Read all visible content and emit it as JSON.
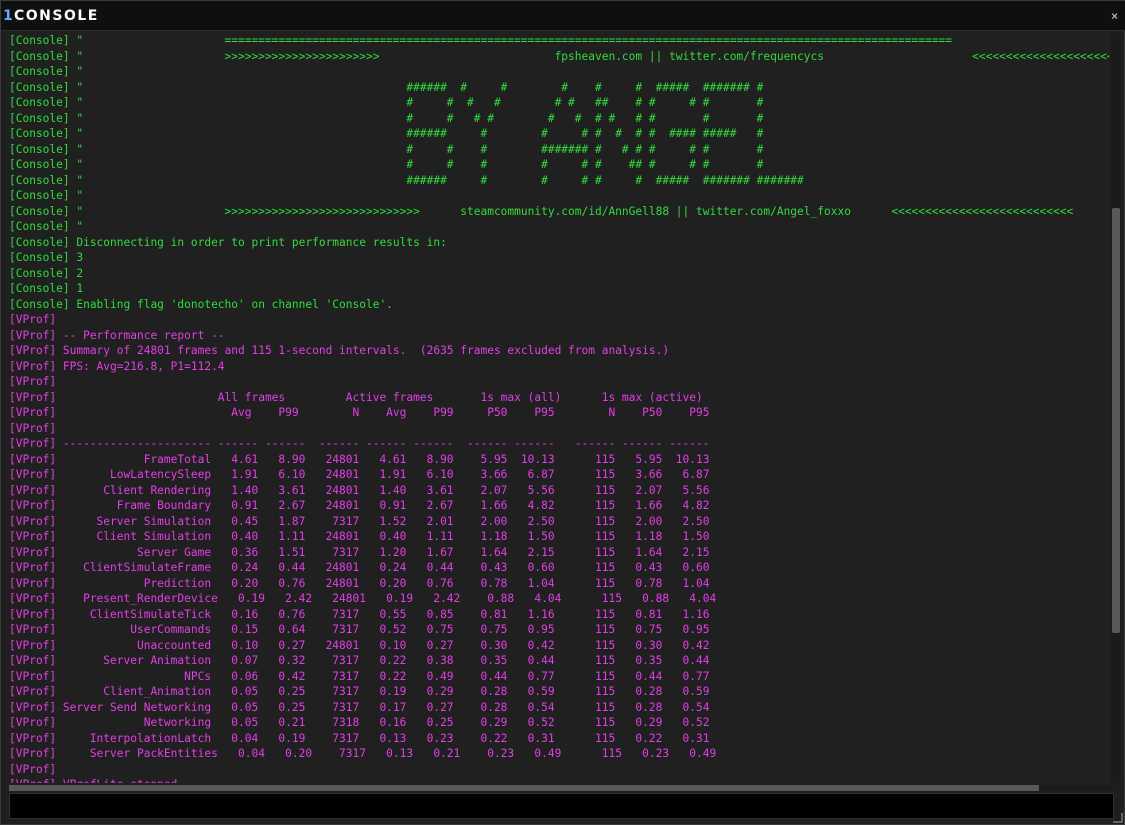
{
  "window": {
    "index": "1",
    "title": "CONSOLE"
  },
  "output": {
    "lines": [
      {
        "c": "console",
        "t": "[Console] \"                     ============================================================================================================"
      },
      {
        "c": "console",
        "t": "[Console] \"                     >>>>>>>>>>>>>>>>>>>>>>>                          fpsheaven.com || twitter.com/frequencycs                      <<<<<<<<<<<<<<<<<<<<<<<"
      },
      {
        "c": "console",
        "t": "[Console] \""
      },
      {
        "c": "console",
        "t": "[Console] \"                                                ######  #     #        #    #     #  #####  ####### #"
      },
      {
        "c": "console",
        "t": "[Console] \"                                                #     #  #   #        # #   ##    # #     # #       #"
      },
      {
        "c": "console",
        "t": "[Console] \"                                                #     #   # #        #   #  # #   # #       #       #"
      },
      {
        "c": "console",
        "t": "[Console] \"                                                ######     #        #     # #  #  # #  #### #####   #"
      },
      {
        "c": "console",
        "t": "[Console] \"                                                #     #    #        ####### #   # # #     # #       #"
      },
      {
        "c": "console",
        "t": "[Console] \"                                                #     #    #        #     # #    ## #     # #       #"
      },
      {
        "c": "console",
        "t": "[Console] \"                                                ######     #        #     # #     #  #####  ####### #######"
      },
      {
        "c": "console",
        "t": "[Console] \""
      },
      {
        "c": "console",
        "t": "[Console] \"                     >>>>>>>>>>>>>>>>>>>>>>>>>>>>>      steamcommunity.com/id/AnnGell88 || twitter.com/Angel_foxxo      <<<<<<<<<<<<<<<<<<<<<<<<<<<"
      },
      {
        "c": "console",
        "t": "[Console] \""
      },
      {
        "c": "console",
        "t": "[Console] Disconnecting in order to print performance results in:"
      },
      {
        "c": "console",
        "t": "[Console] 3"
      },
      {
        "c": "console",
        "t": "[Console] 2"
      },
      {
        "c": "console",
        "t": "[Console] 1"
      },
      {
        "c": "console",
        "t": "[Console] Enabling flag 'donotecho' on channel 'Console'."
      },
      {
        "c": "vprof",
        "t": "[VProf]"
      },
      {
        "c": "vprof",
        "t": "[VProf] -- Performance report --"
      },
      {
        "c": "vprof",
        "t": "[VProf] Summary of 24801 frames and 115 1-second intervals.  (2635 frames excluded from analysis.)"
      },
      {
        "c": "vprof",
        "t": "[VProf] FPS: Avg=216.8, P1=112.4"
      },
      {
        "c": "vprof",
        "t": "[VProf]"
      },
      {
        "c": "vprof",
        "t": "[VProf]                        All frames         Active frames       1s max (all)      1s max (active)"
      },
      {
        "c": "vprof",
        "t": "[VProf]                          Avg    P99        N    Avg    P99     P50    P95        N    P50    P95"
      },
      {
        "c": "vprof",
        "t": "[VProf]"
      },
      {
        "c": "vprof",
        "t": "[VProf] ---------------------- ------ ------  ------ ------ ------  ------ ------   ------ ------ ------"
      },
      {
        "c": "vprof",
        "t": "[VProf]             FrameTotal   4.61   8.90   24801   4.61   8.90    5.95  10.13      115   5.95  10.13"
      },
      {
        "c": "vprof",
        "t": "[VProf]        LowLatencySleep   1.91   6.10   24801   1.91   6.10    3.66   6.87      115   3.66   6.87"
      },
      {
        "c": "vprof",
        "t": "[VProf]       Client Rendering   1.40   3.61   24801   1.40   3.61    2.07   5.56      115   2.07   5.56"
      },
      {
        "c": "vprof",
        "t": "[VProf]         Frame Boundary   0.91   2.67   24801   0.91   2.67    1.66   4.82      115   1.66   4.82"
      },
      {
        "c": "vprof",
        "t": "[VProf]      Server Simulation   0.45   1.87    7317   1.52   2.01    2.00   2.50      115   2.00   2.50"
      },
      {
        "c": "vprof",
        "t": "[VProf]      Client Simulation   0.40   1.11   24801   0.40   1.11    1.18   1.50      115   1.18   1.50"
      },
      {
        "c": "vprof",
        "t": "[VProf]            Server Game   0.36   1.51    7317   1.20   1.67    1.64   2.15      115   1.64   2.15"
      },
      {
        "c": "vprof",
        "t": "[VProf]    ClientSimulateFrame   0.24   0.44   24801   0.24   0.44    0.43   0.60      115   0.43   0.60"
      },
      {
        "c": "vprof",
        "t": "[VProf]             Prediction   0.20   0.76   24801   0.20   0.76    0.78   1.04      115   0.78   1.04"
      },
      {
        "c": "vprof",
        "t": "[VProf]    Present_RenderDevice   0.19   2.42   24801   0.19   2.42    0.88   4.04      115   0.88   4.04"
      },
      {
        "c": "vprof",
        "t": "[VProf]     ClientSimulateTick   0.16   0.76    7317   0.55   0.85    0.81   1.16      115   0.81   1.16"
      },
      {
        "c": "vprof",
        "t": "[VProf]           UserCommands   0.15   0.64    7317   0.52   0.75    0.75   0.95      115   0.75   0.95"
      },
      {
        "c": "vprof",
        "t": "[VProf]            Unaccounted   0.10   0.27   24801   0.10   0.27    0.30   0.42      115   0.30   0.42"
      },
      {
        "c": "vprof",
        "t": "[VProf]       Server Animation   0.07   0.32    7317   0.22   0.38    0.35   0.44      115   0.35   0.44"
      },
      {
        "c": "vprof",
        "t": "[VProf]                   NPCs   0.06   0.42    7317   0.22   0.49    0.44   0.77      115   0.44   0.77"
      },
      {
        "c": "vprof",
        "t": "[VProf]       Client_Animation   0.05   0.25    7317   0.19   0.29    0.28   0.59      115   0.28   0.59"
      },
      {
        "c": "vprof",
        "t": "[VProf] Server Send Networking   0.05   0.25    7317   0.17   0.27    0.28   0.54      115   0.28   0.54"
      },
      {
        "c": "vprof",
        "t": "[VProf]             Networking   0.05   0.21    7318   0.16   0.25    0.29   0.52      115   0.29   0.52"
      },
      {
        "c": "vprof",
        "t": "[VProf]     InterpolationLatch   0.04   0.19    7317   0.13   0.23    0.22   0.31      115   0.22   0.31"
      },
      {
        "c": "vprof",
        "t": "[VProf]     Server PackEntities   0.04   0.20    7317   0.13   0.21    0.23   0.49      115   0.23   0.49"
      },
      {
        "c": "vprof",
        "t": "[VProf]"
      },
      {
        "c": "vprof",
        "t": "[VProf] VProfLite stopped."
      }
    ]
  },
  "input": {
    "value": ""
  },
  "icons": {
    "close": "close-icon"
  },
  "colors": {
    "console_text": "#2fdd3c",
    "vprof_text": "#e23fe6",
    "title_accent": "#6aa6ff"
  }
}
